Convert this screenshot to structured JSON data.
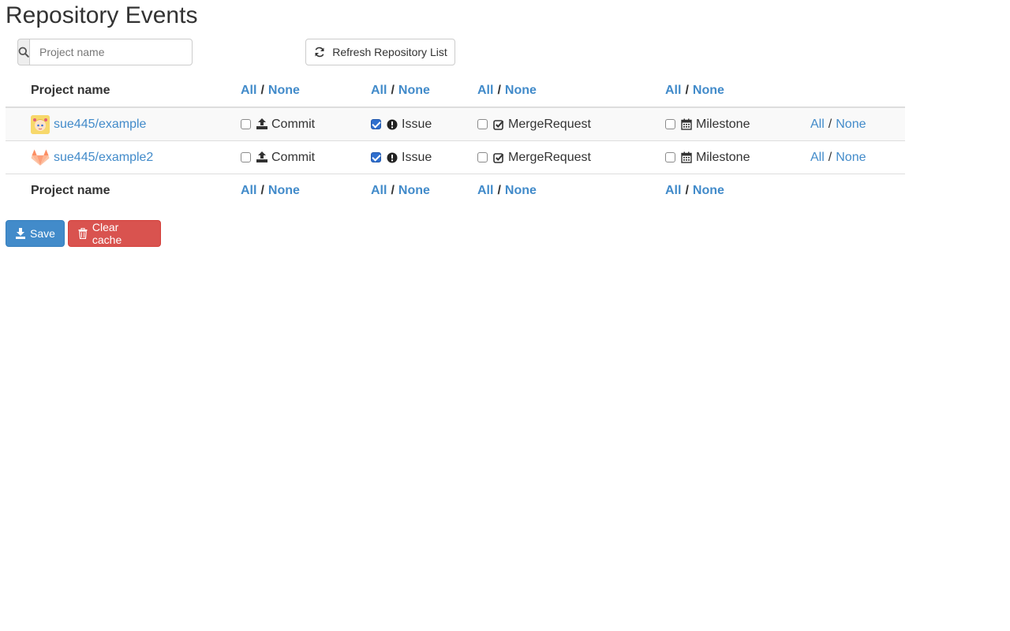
{
  "page": {
    "title": "Repository Events"
  },
  "search": {
    "placeholder": "Project name",
    "icon": "search-icon"
  },
  "toolbar": {
    "refresh_label": "Refresh Repository List",
    "save_label": "Save",
    "clear_cache_label": "Clear cache"
  },
  "table": {
    "name_header": "Project name",
    "all_label": "All",
    "none_label": "None",
    "separator": "/",
    "rows": [
      {
        "project": "sue445/example",
        "avatar": "anime-avatar",
        "commit": {
          "label": "Commit",
          "checked": false
        },
        "issue": {
          "label": "Issue",
          "checked": true
        },
        "merge_request": {
          "label": "MergeRequest",
          "checked": false
        },
        "milestone": {
          "label": "Milestone",
          "checked": false
        }
      },
      {
        "project": "sue445/example2",
        "avatar": "gitlab-fox-avatar",
        "commit": {
          "label": "Commit",
          "checked": false
        },
        "issue": {
          "label": "Issue",
          "checked": true
        },
        "merge_request": {
          "label": "MergeRequest",
          "checked": false
        },
        "milestone": {
          "label": "Milestone",
          "checked": false
        }
      }
    ]
  },
  "colors": {
    "link": "#428bca",
    "primary": "#428bca",
    "danger": "#d9534f",
    "stripe": "#f9f9f9"
  }
}
